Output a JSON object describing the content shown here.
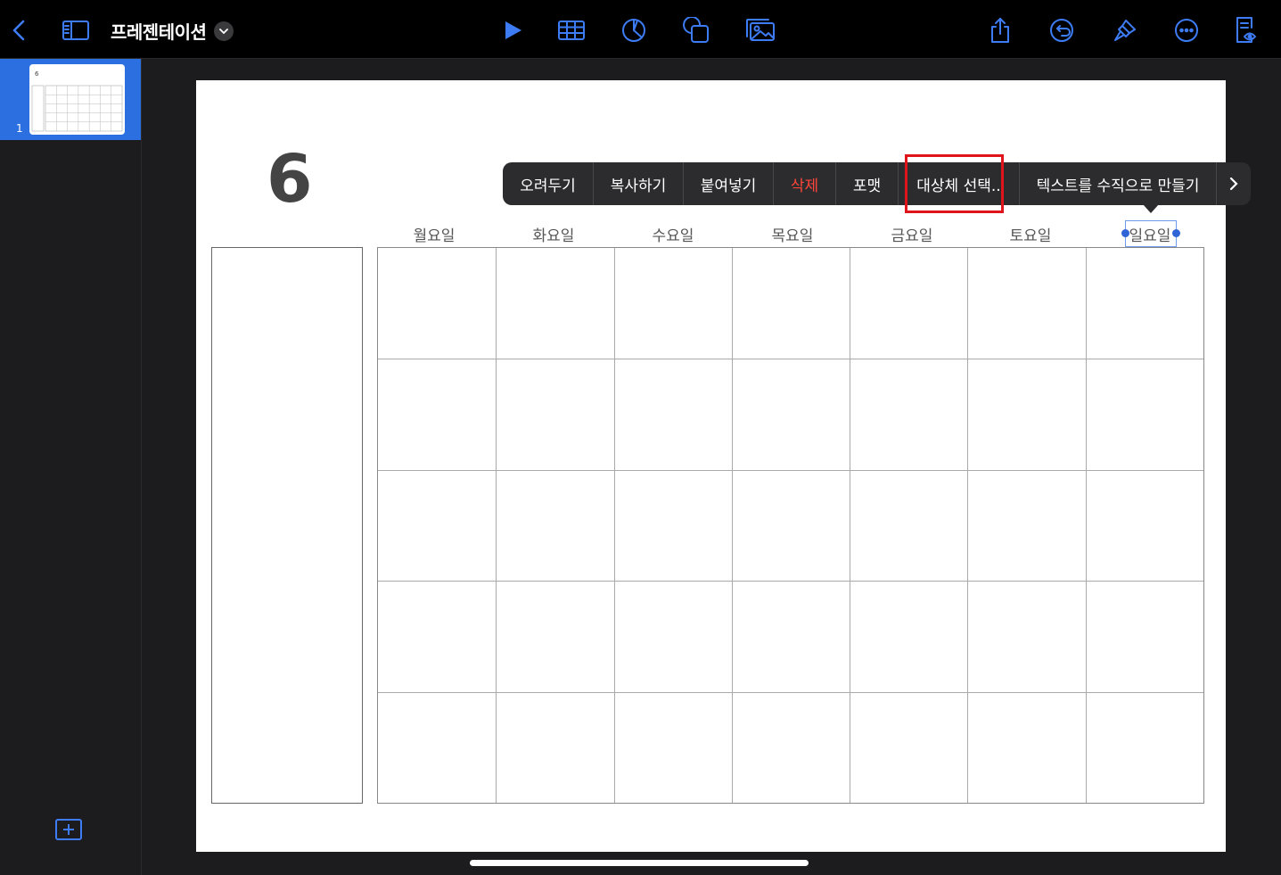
{
  "toolbar": {
    "title": "프레젠테이션",
    "colors": {
      "accent": "#3d7cf4"
    }
  },
  "sidebar": {
    "slides": [
      {
        "number": "1",
        "thumb_title": "6"
      }
    ]
  },
  "canvas": {
    "big_number": "6",
    "days": [
      "월요일",
      "화요일",
      "수요일",
      "목요일",
      "금요일",
      "토요일",
      "일요일"
    ],
    "rows": 5
  },
  "context_menu": {
    "items": [
      {
        "label": "오려두기",
        "danger": false
      },
      {
        "label": "복사하기",
        "danger": false
      },
      {
        "label": "붙여넣기",
        "danger": false
      },
      {
        "label": "삭제",
        "danger": true
      },
      {
        "label": "포맷",
        "danger": false
      },
      {
        "label": "대상체 선택..",
        "danger": false
      },
      {
        "label": "텍스트를 수직으로 만들기",
        "danger": false
      }
    ],
    "more_icon": "chevron-right-icon"
  }
}
